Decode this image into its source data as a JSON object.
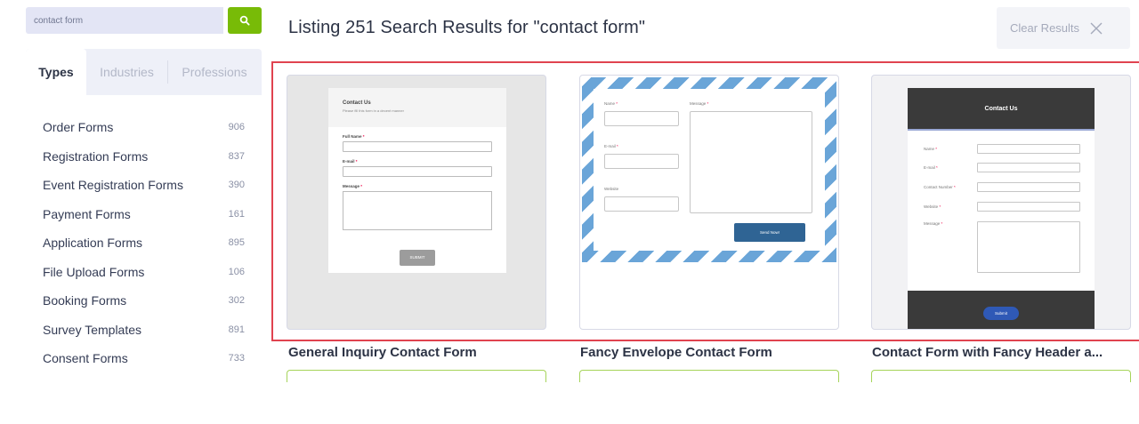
{
  "search": {
    "value": "contact form",
    "button_icon": "search-icon"
  },
  "sidebar": {
    "tabs": [
      {
        "label": "Types",
        "active": true
      },
      {
        "label": "Industries",
        "active": false
      },
      {
        "label": "Professions",
        "active": false
      }
    ],
    "categories": [
      {
        "label": "Order Forms",
        "count": "906"
      },
      {
        "label": "Registration Forms",
        "count": "837"
      },
      {
        "label": "Event Registration Forms",
        "count": "390"
      },
      {
        "label": "Payment Forms",
        "count": "161"
      },
      {
        "label": "Application Forms",
        "count": "895"
      },
      {
        "label": "File Upload Forms",
        "count": "106"
      },
      {
        "label": "Booking Forms",
        "count": "302"
      },
      {
        "label": "Survey Templates",
        "count": "891"
      },
      {
        "label": "Consent Forms",
        "count": "733"
      }
    ]
  },
  "results": {
    "title": "Listing 251 Search Results for \"contact form\"",
    "clear_label": "Clear Results",
    "clear_icon": "close-icon"
  },
  "colors": {
    "accent_green": "#78bb07",
    "highlight_red": "#e0434f",
    "envelope_blue": "#6aa5d8"
  },
  "cards": [
    {
      "title": "General Inquiry Contact Form",
      "preview": {
        "heading": "Contact Us",
        "subheading": "Please fill this form in a decent manner",
        "fields": [
          "Full Name",
          "E-mail",
          "Message"
        ],
        "submit": "SUBMIT"
      }
    },
    {
      "title": "Fancy Envelope Contact Form",
      "preview": {
        "fields": [
          "Name",
          "E-mail",
          "Website"
        ],
        "message_label": "Message",
        "submit": "Send Now!"
      }
    },
    {
      "title": "Contact Form with Fancy Header a...",
      "preview": {
        "heading": "Contact Us",
        "fields": [
          "Name",
          "E-mail",
          "Contact Number",
          "Website",
          "Message"
        ],
        "submit": "Submit"
      }
    }
  ]
}
